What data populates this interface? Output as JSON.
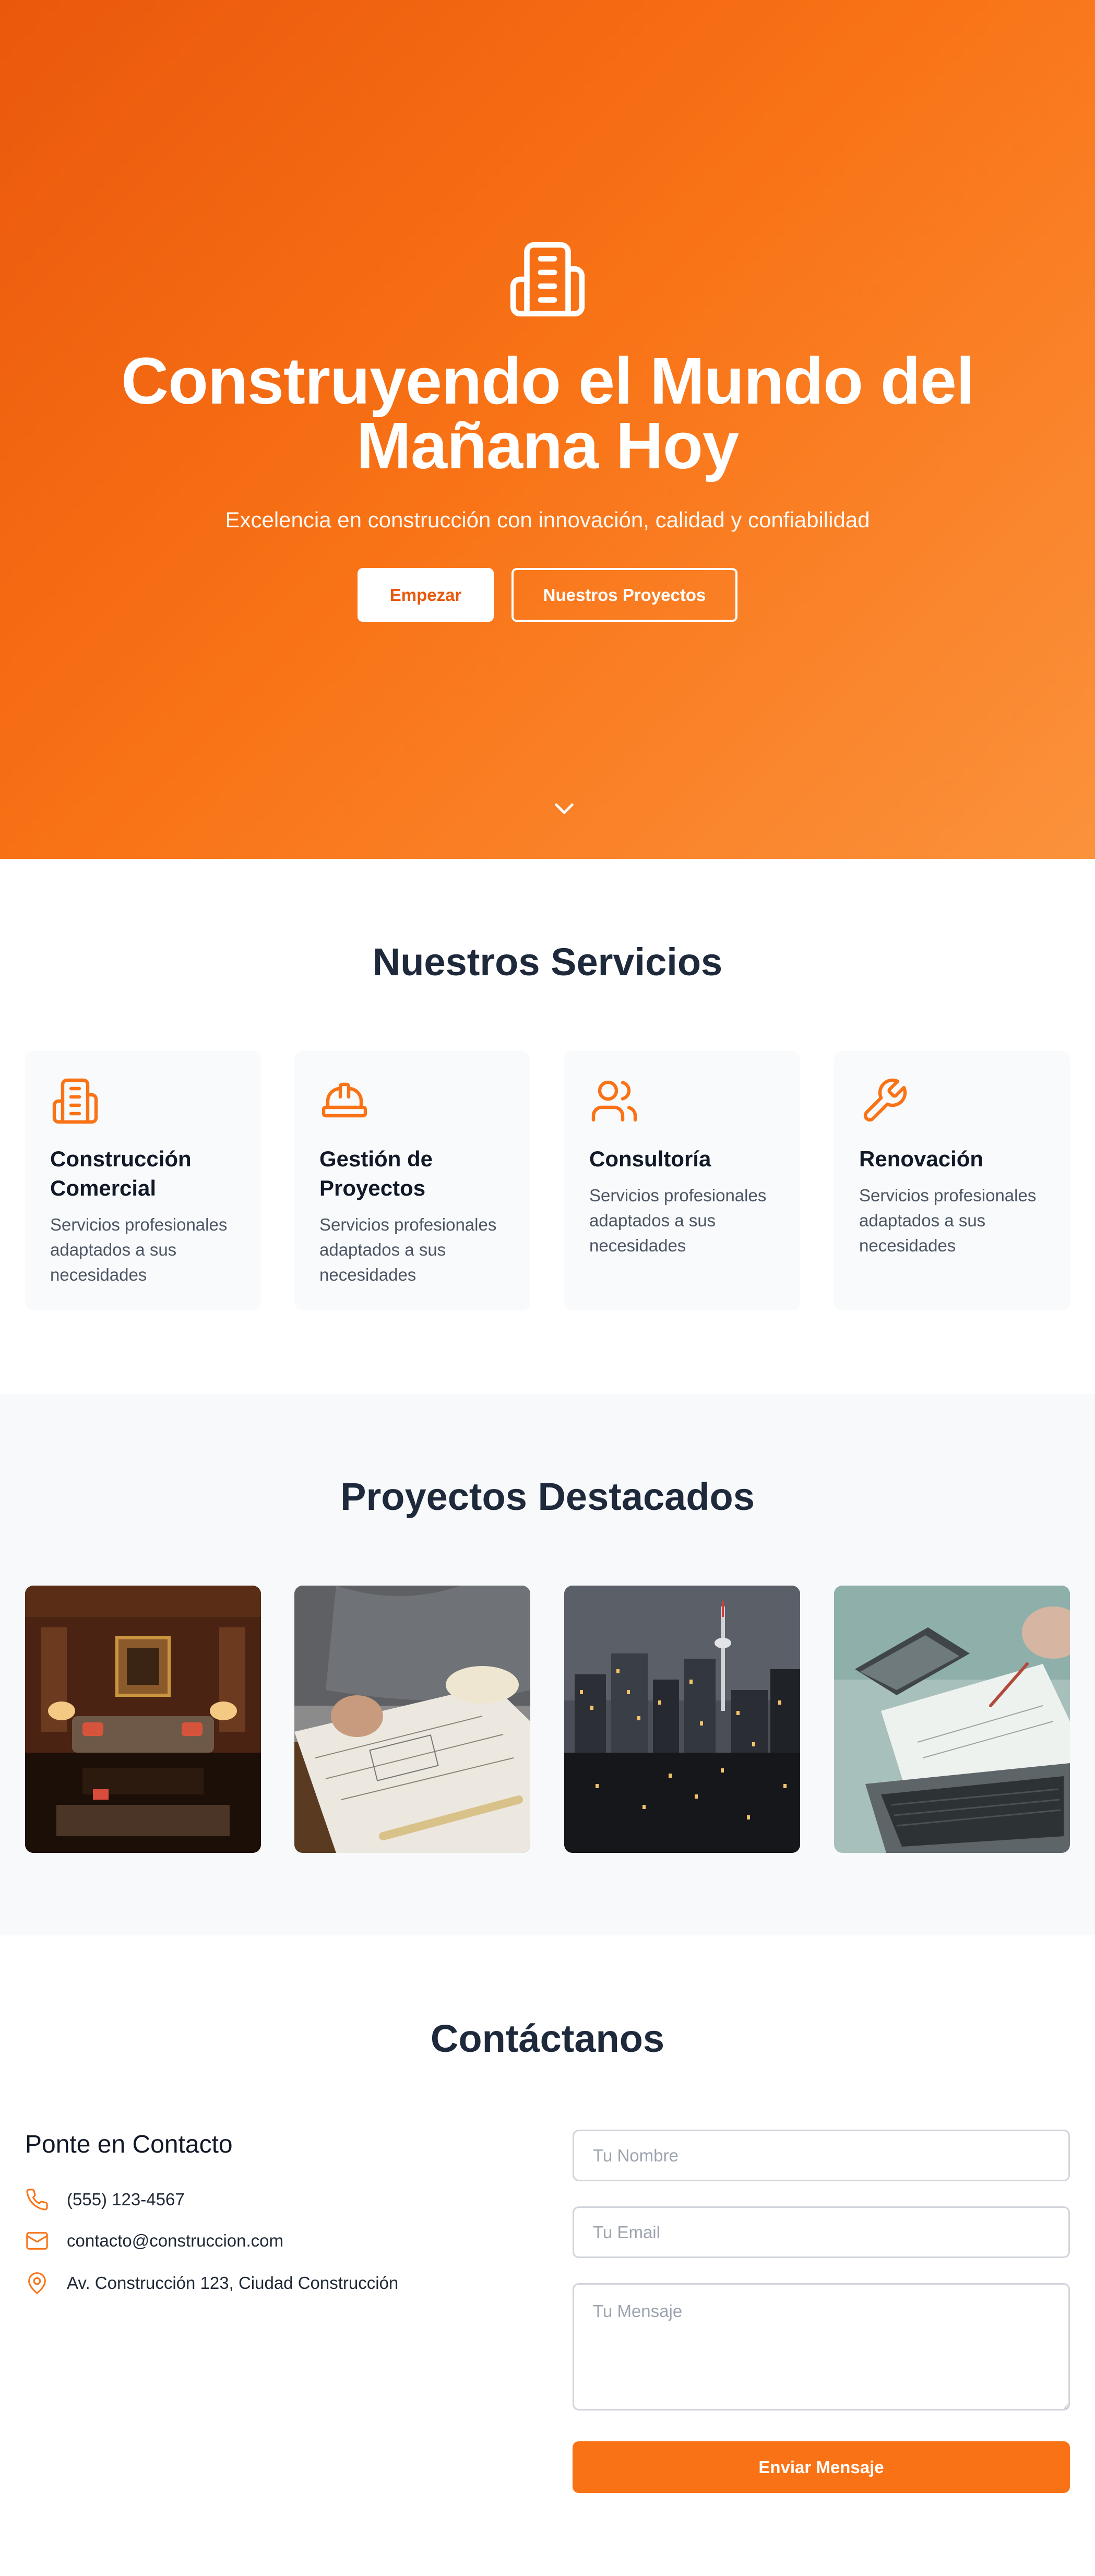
{
  "colors": {
    "accent": "#f97316",
    "accent_dark": "#ea580c",
    "heading": "#1e293b",
    "muted": "#4b5563",
    "light_bg": "#f9fafb"
  },
  "hero": {
    "icon": "building-icon",
    "title_line1": "Construyendo el Mundo del",
    "title_line2": "Mañana Hoy",
    "subtitle": "Excelencia en construcción con innovación, calidad y confiabilidad",
    "primary_button": "Empezar",
    "secondary_button": "Nuestros Proyectos",
    "scroll_icon": "chevron-down-icon"
  },
  "services": {
    "title": "Nuestros Servicios",
    "items": [
      {
        "icon": "building-icon",
        "title_line1": "Construcción",
        "title_line2": "Comercial",
        "desc": [
          "Servicios profesionales",
          "adaptados a sus",
          "necesidades"
        ]
      },
      {
        "icon": "hard-hat-icon",
        "title_line1": "Gestión de",
        "title_line2": "Proyectos",
        "desc": [
          "Servicios profesionales",
          "adaptados a sus",
          "necesidades"
        ]
      },
      {
        "icon": "users-icon",
        "title_line1": "Consultoría",
        "title_line2": "",
        "desc": [
          "Servicios profesionales",
          "adaptados a sus",
          "necesidades"
        ]
      },
      {
        "icon": "wrench-icon",
        "title_line1": "Renovación",
        "title_line2": "",
        "desc": [
          "Servicios profesionales",
          "adaptados a sus",
          "necesidades"
        ]
      }
    ]
  },
  "projects": {
    "title": "Proyectos Destacados",
    "items": [
      {
        "image": "interior-lounge-photo"
      },
      {
        "image": "blueprint-drawing-photo"
      },
      {
        "image": "city-skyline-night-photo"
      },
      {
        "image": "laptop-paperwork-photo"
      }
    ]
  },
  "contact": {
    "title": "Contáctanos",
    "heading": "Ponte en Contacto",
    "phone_icon": "phone-icon",
    "phone": "(555) 123-4567",
    "email_icon": "mail-icon",
    "email": "contacto@construccion.com",
    "address_icon": "map-pin-icon",
    "address": "Av. Construcción 123, Ciudad Construcción",
    "form": {
      "name_placeholder": "Tu Nombre",
      "email_placeholder": "Tu Email",
      "message_placeholder": "Tu Mensaje",
      "name_value": "",
      "email_value": "",
      "message_value": "",
      "submit": "Enviar Mensaje"
    }
  }
}
